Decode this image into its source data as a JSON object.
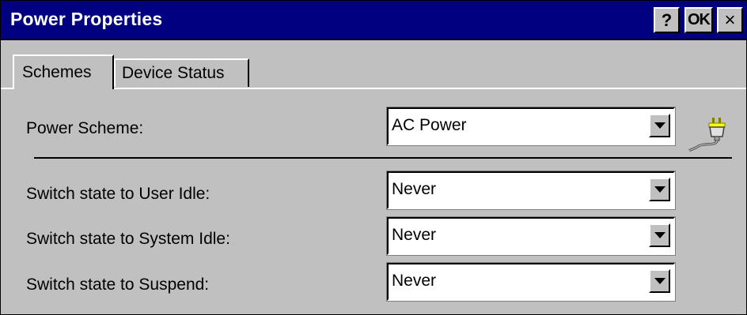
{
  "window": {
    "title": "Power Properties",
    "help_label": "?",
    "ok_label": "OK",
    "close_label": "×"
  },
  "tabs": [
    {
      "label": "Schemes",
      "active": true
    },
    {
      "label": "Device Status",
      "active": false
    }
  ],
  "power_scheme": {
    "label": "Power Scheme:",
    "value": "AC Power",
    "icon": "power-plug-icon"
  },
  "settings": [
    {
      "label": "Switch state to User Idle:",
      "value": "Never"
    },
    {
      "label": "Switch state to System Idle:",
      "value": "Never"
    },
    {
      "label": "Switch state to Suspend:",
      "value": "Never"
    }
  ],
  "colors": {
    "titlebar": "#000080",
    "face": "#c0c0c0"
  }
}
